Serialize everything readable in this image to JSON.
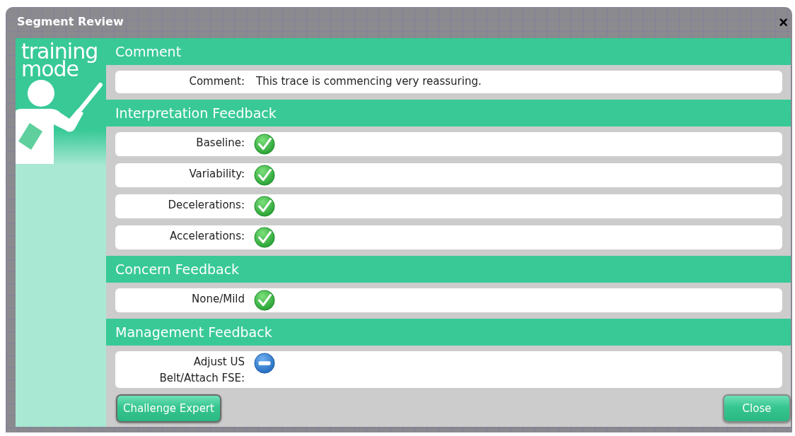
{
  "window": {
    "title": "Segment Review",
    "close": "×"
  },
  "sidebar": {
    "line_1": "training",
    "line_2": "mode"
  },
  "sections": [
    {
      "title": "Comment",
      "rows": [
        {
          "label": "Comment:",
          "kind": "text",
          "value": "This trace is commencing very reassuring."
        }
      ]
    },
    {
      "title": "Interpretation Feedback",
      "rows": [
        {
          "label": "Baseline:",
          "kind": "check"
        },
        {
          "label": "Variability:",
          "kind": "check"
        },
        {
          "label": "Decelerations:",
          "kind": "check"
        },
        {
          "label": "Accelerations:",
          "kind": "check"
        }
      ]
    },
    {
      "title": "Concern Feedback",
      "rows": [
        {
          "label": "None/Mild",
          "kind": "check"
        }
      ]
    },
    {
      "title": "Management Feedback",
      "rows": [
        {
          "label": "Adjust US Belt/Attach FSE:",
          "kind": "minus"
        }
      ]
    }
  ],
  "buttons": {
    "left": "Challenge Expert",
    "right": "Close"
  }
}
